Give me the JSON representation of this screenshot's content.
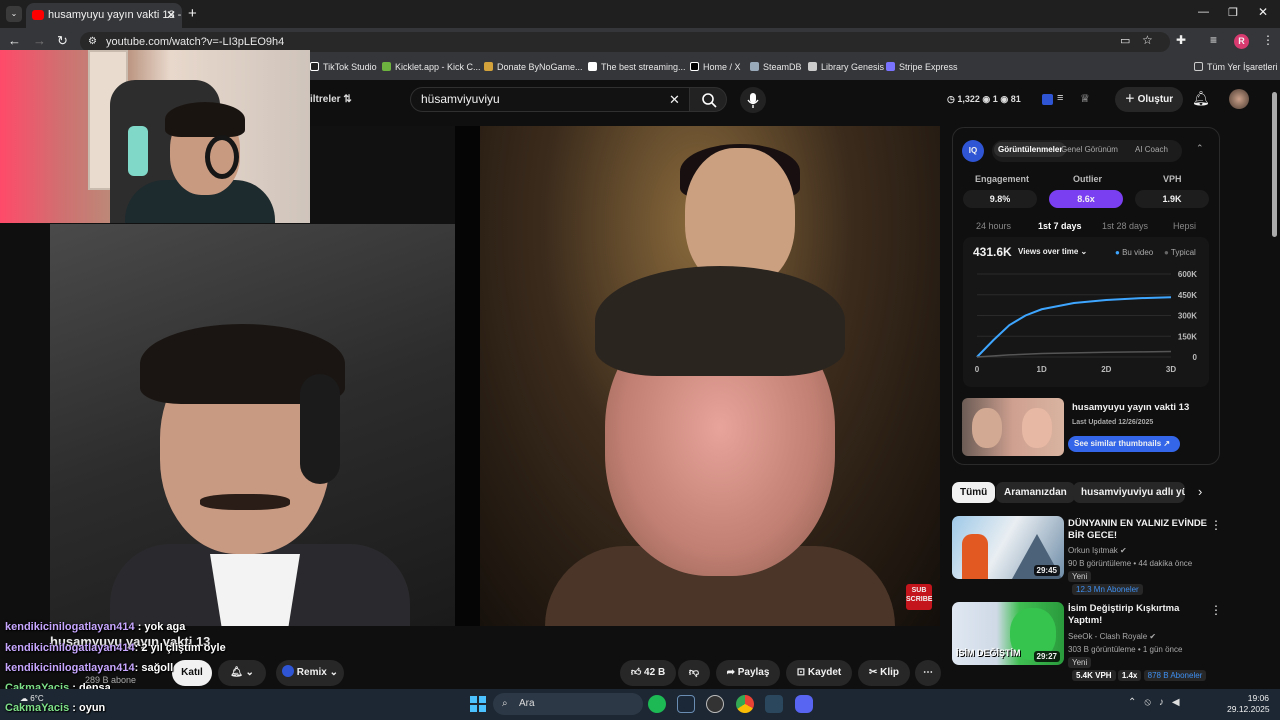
{
  "browser": {
    "tab_title": "husamyuyu yayın vakti 13 - You",
    "url": "youtube.com/watch?v=-LI3pLEO9h4",
    "bookmarks": [
      "TikTok Studio",
      "Kicklet.app - Kick C...",
      "Donate ByNoGame...",
      "The best streaming...",
      "Home / X",
      "SteamDB",
      "Library Genesis",
      "Stripe Express"
    ],
    "all_bookmarks": "Tüm Yer İşaretleri",
    "profile_initial": "R"
  },
  "youtube": {
    "filters_label": "iltreler",
    "search_value": "hüsamviyuviyu",
    "stats": {
      "a": "1,322",
      "b": "1",
      "c": "81"
    },
    "create_label": "Oluştur"
  },
  "video": {
    "subscribe_overlay": "SUB SCRIBE",
    "title_partial": "husamyuyu yayın vakti 13",
    "subscribers": "289 B abone",
    "join_label": "Katıl",
    "remix_label": "Remix",
    "likes": "42 B",
    "share_label": "Paylaş",
    "save_label": "Kaydet",
    "clip_label": "Klip"
  },
  "chat": [
    {
      "user": "kendikicinilogatlayan414",
      "msg": ": yok aga"
    },
    {
      "user": "kendikicinilogatlayan414",
      "msg": ": 2 yıl çliştim öyle"
    },
    {
      "user": "kendikicinilogatlayan414",
      "msg": ": sağoll"
    },
    {
      "user": "CakmaYacis",
      "msg": ": densa"
    },
    {
      "user": "CakmaYacis",
      "msg": ": oyun"
    }
  ],
  "iq": {
    "badge": "IQ",
    "tabs": [
      "Görüntülenmeler",
      "Genel Görünüm",
      "AI Coach"
    ],
    "metrics": [
      {
        "label": "Engagement",
        "value": "9.8%"
      },
      {
        "label": "Outlier",
        "value": "8.6x"
      },
      {
        "label": "VPH",
        "value": "1.9K"
      }
    ],
    "ranges": [
      "24 hours",
      "1st 7 days",
      "1st 28 days",
      "Hepsi"
    ],
    "total_views": "431.6K",
    "views_dropdown": "Views over time",
    "legend": [
      "Bu video",
      "Typical"
    ],
    "thumb_title": "husamyuyu yayın vakti 13",
    "last_updated": "Last Updated 12/26/2025",
    "similar_btn": "See similar thumbnails ↗",
    "accent": "#3ea6ff"
  },
  "chart_data": {
    "type": "line",
    "x_ticks": [
      "0",
      "1D",
      "2D",
      "3D"
    ],
    "y_ticks": [
      "600K",
      "450K",
      "300K",
      "150K",
      "0"
    ],
    "ylim": [
      0,
      600000
    ],
    "xlim": [
      0,
      3
    ],
    "series": [
      {
        "name": "Bu video",
        "x": [
          0,
          0.25,
          0.5,
          0.75,
          1,
          1.5,
          2,
          2.5,
          3
        ],
        "values": [
          0,
          120000,
          230000,
          300000,
          345000,
          390000,
          412000,
          425000,
          432000
        ]
      },
      {
        "name": "Typical",
        "x": [
          0,
          0.5,
          1,
          1.5,
          2,
          2.5,
          3
        ],
        "values": [
          0,
          15000,
          25000,
          30000,
          34000,
          37000,
          40000
        ]
      }
    ]
  },
  "chips": [
    "Tümü",
    "Aramanızdan",
    "husamviyuviyu adlı yükle"
  ],
  "recommended": [
    {
      "title": "DÜNYANIN EN YALNIZ EVİNDE BİR GECE!",
      "channel": "Orkun Işıtmak",
      "meta": "90 B görüntüleme • 44 dakika önce",
      "badge": "Yeni",
      "subs": "12.3 Mn Aboneler",
      "duration": "29:45"
    },
    {
      "title": "İsim Değiştirip Kışkırtma Yaptım!",
      "channel": "SeeOk - Clash Royale",
      "meta": "303 B görüntüleme • 1 gün önce",
      "badge": "Yeni",
      "vph": "5.4K VPH",
      "ratio": "1.4x",
      "subs": "878 B Aboneler",
      "duration": "29:27",
      "thumb_text": "İSİM DEĞİŞTİM"
    }
  ],
  "taskbar": {
    "search_placeholder": "Ara",
    "weather": "6°C",
    "time": "19:06",
    "date": "29.12.2025"
  }
}
